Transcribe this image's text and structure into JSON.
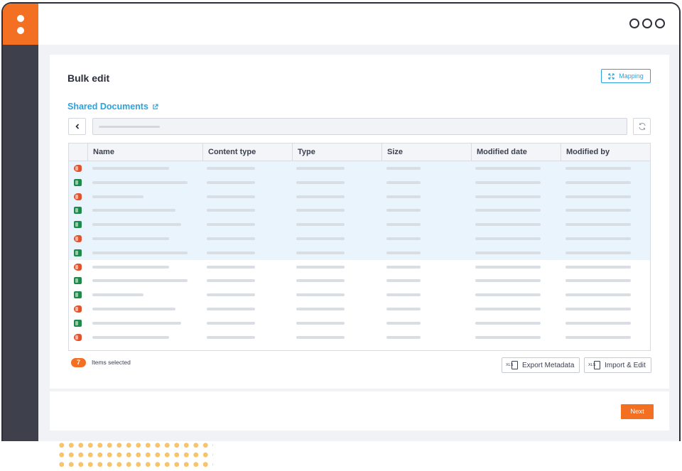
{
  "header": {
    "title": "Bulk edit",
    "mapping_label": "Mapping"
  },
  "library": {
    "name": "Shared Documents"
  },
  "columns": [
    "Name",
    "Content type",
    "Type",
    "Size",
    "Modified date",
    "Modified by"
  ],
  "rows": [
    {
      "icon": "powerpoint-icon",
      "selected": true
    },
    {
      "icon": "excel-icon",
      "selected": true
    },
    {
      "icon": "powerpoint-icon",
      "selected": true
    },
    {
      "icon": "excel-icon",
      "selected": true
    },
    {
      "icon": "excel-icon",
      "selected": true
    },
    {
      "icon": "powerpoint-icon",
      "selected": true
    },
    {
      "icon": "excel-icon",
      "selected": true
    },
    {
      "icon": "powerpoint-icon",
      "selected": false
    },
    {
      "icon": "excel-icon",
      "selected": false
    },
    {
      "icon": "excel-icon",
      "selected": false
    },
    {
      "icon": "powerpoint-icon",
      "selected": false
    },
    {
      "icon": "excel-icon",
      "selected": false
    },
    {
      "icon": "powerpoint-icon",
      "selected": false
    }
  ],
  "selection": {
    "count": "7",
    "label": "Items selected"
  },
  "actions": {
    "export_label": "Export Metadata",
    "import_label": "Import & Edit",
    "xls_tag": "XLS"
  },
  "footer": {
    "next_label": "Next"
  },
  "colors": {
    "accent": "#f36f21",
    "link": "#2ba3de",
    "sidebar": "#3e404b",
    "selected_row": "#e9f4fc"
  }
}
